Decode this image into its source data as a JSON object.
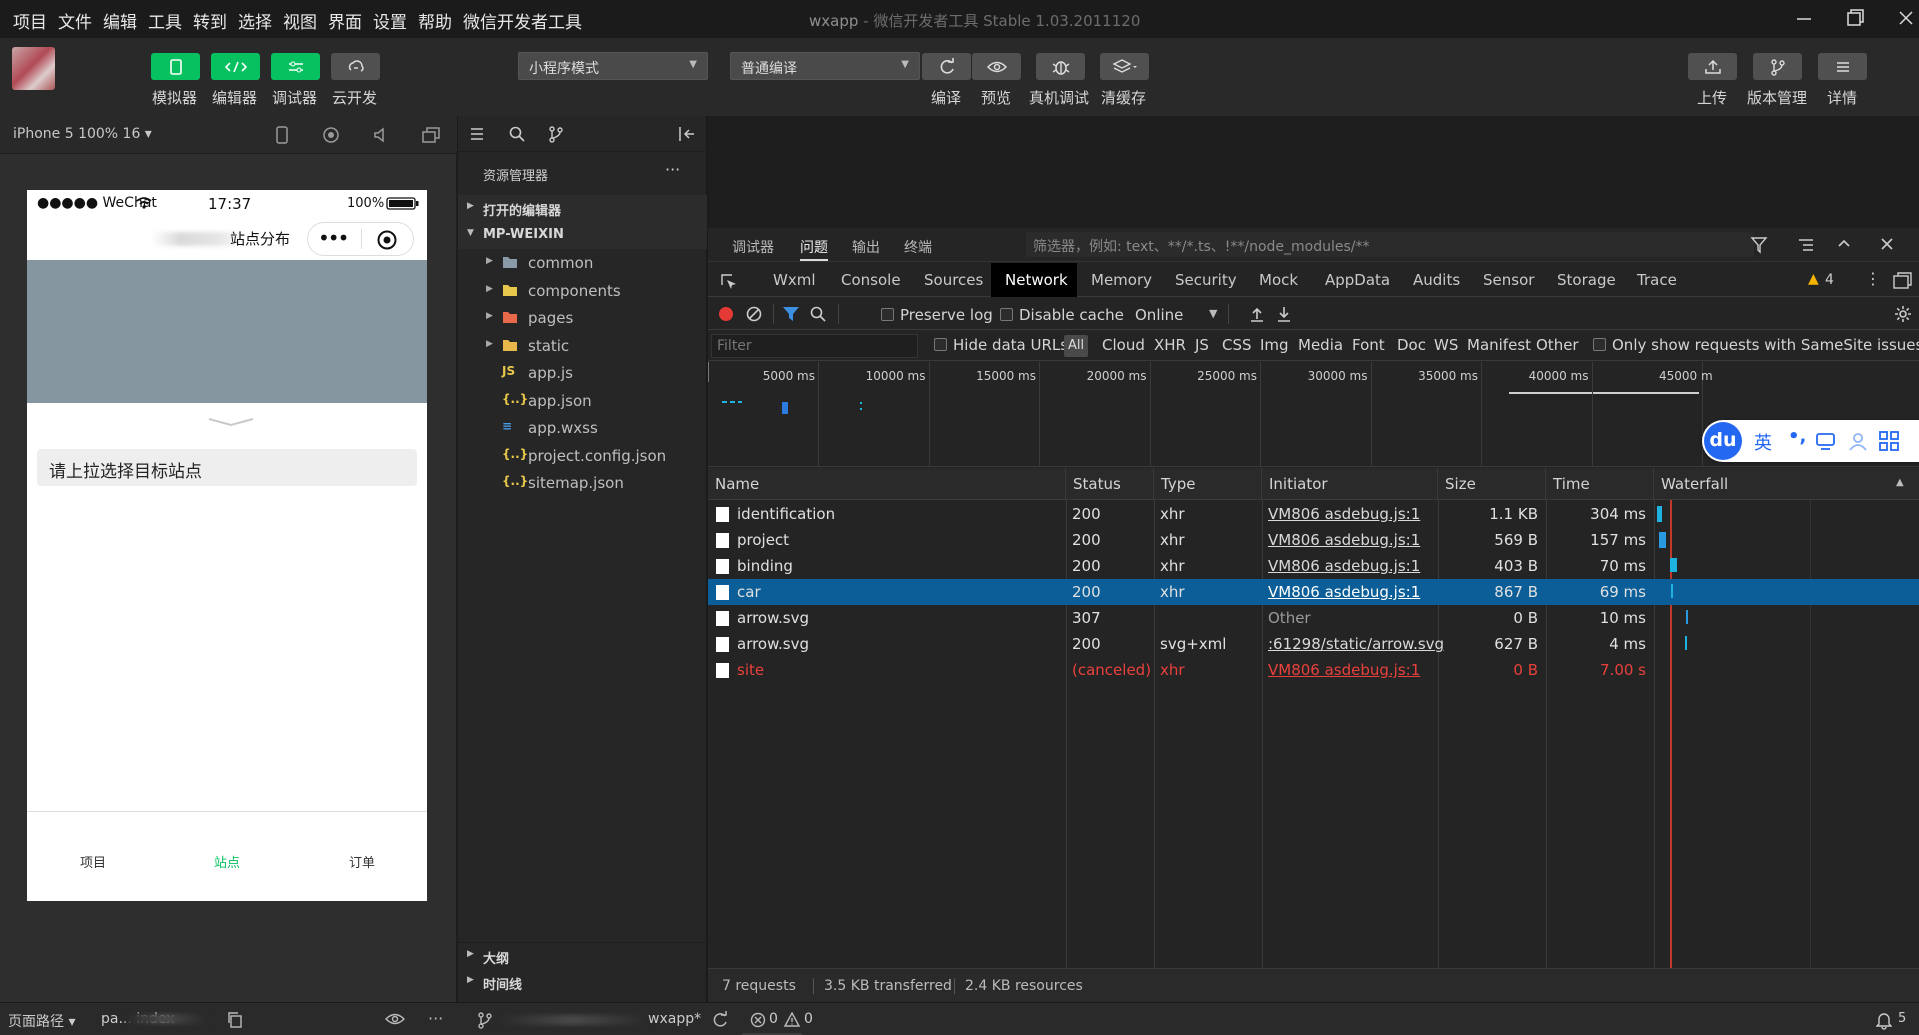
{
  "menubar": {
    "items": [
      "项目",
      "文件",
      "编辑",
      "工具",
      "转到",
      "选择",
      "视图",
      "界面",
      "设置",
      "帮助",
      "微信开发者工具"
    ],
    "title": "wxapp",
    "title_sub": " - 微信开发者工具 Stable 1.03.2011120"
  },
  "toolbar": {
    "simulator_label": "模拟器",
    "editor_label": "编辑器",
    "debugger_label": "调试器",
    "cloud_label": "云开发",
    "mode_select": "小程序模式",
    "compile_select": "普通编译",
    "compile_label": "编译",
    "preview_label": "预览",
    "remote_debug_label": "真机调试",
    "clear_cache_label": "清缓存",
    "upload_label": "上传",
    "version_label": "版本管理",
    "details_label": "详情",
    "accent": "#07c160"
  },
  "simulator": {
    "device": "iPhone 5 100% 16 ▾",
    "status_carrier": "●●●●● WeChat",
    "status_time": "17:37",
    "status_battery": "100%",
    "nav_title": "站点分布",
    "hint_text": "请上拉选择目标站点",
    "tabs": [
      "项目",
      "站点",
      "订单"
    ],
    "active_tab_color": "#07c160",
    "map_color": "#8596a1"
  },
  "explorer": {
    "title": "资源管理器",
    "more": "···",
    "open_editors": "打开的编辑器",
    "root": "MP-WEIXIN",
    "files": [
      {
        "name": "common",
        "icon": "folder-icon",
        "color": "#8a9aa8",
        "folder": true
      },
      {
        "name": "components",
        "icon": "folder-icon",
        "color": "#e8c84a",
        "folder": true
      },
      {
        "name": "pages",
        "icon": "folder-icon",
        "color": "#e86a4a",
        "folder": true
      },
      {
        "name": "static",
        "icon": "folder-icon",
        "color": "#e8b84a",
        "folder": true
      },
      {
        "name": "app.js",
        "icon": "js-file-icon",
        "color": "#e8c84a",
        "folder": false
      },
      {
        "name": "app.json",
        "icon": "json-file-icon",
        "color": "#e8c84a",
        "folder": false
      },
      {
        "name": "app.wxss",
        "icon": "wxss-file-icon",
        "color": "#4a9ae8",
        "folder": false
      },
      {
        "name": "project.config.json",
        "icon": "json-file-icon",
        "color": "#e8c84a",
        "folder": false
      },
      {
        "name": "sitemap.json",
        "icon": "json-file-icon",
        "color": "#e8c84a",
        "folder": false
      }
    ],
    "outline": "大纲",
    "timeline": "时间线"
  },
  "devtools": {
    "top_tabs": [
      "调试器",
      "问题",
      "输出",
      "终端"
    ],
    "filter_placeholder": "筛选器，例如: text、**/*.ts、!**/node_modules/**",
    "panel_tabs": [
      "Wxml",
      "Console",
      "Sources",
      "Network",
      "Memory",
      "Security",
      "Mock",
      "AppData",
      "Audits",
      "Sensor",
      "Storage",
      "Trace"
    ],
    "active_panel": "Network",
    "warning_count": "4",
    "preserve_log": "Preserve log",
    "disable_cache": "Disable cache",
    "throttle": "Online",
    "filter_input_placeholder": "Filter",
    "hide_data_urls": "Hide data URLs",
    "filter_types": [
      "All",
      "Cloud",
      "XHR",
      "JS",
      "CSS",
      "Img",
      "Media",
      "Font",
      "Doc",
      "WS",
      "Manifest",
      "Other"
    ],
    "samesite": "Only show requests with SameSite issues",
    "timeline_ticks": [
      "5000 ms",
      "10000 ms",
      "15000 ms",
      "20000 ms",
      "25000 ms",
      "30000 ms",
      "35000 ms",
      "40000 ms",
      "45000 m"
    ],
    "ime": {
      "logo": "du",
      "lang": "英",
      "punct": "•,"
    },
    "columns": [
      "Name",
      "Status",
      "Type",
      "Initiator",
      "Size",
      "Time",
      "Waterfall"
    ],
    "rows": [
      {
        "name": "identification",
        "status": "200",
        "type": "xhr",
        "initiator": "VM806 asdebug.js:1",
        "size": "1.1 KB",
        "time": "304 ms",
        "selected": false,
        "error": false,
        "link": true
      },
      {
        "name": "project",
        "status": "200",
        "type": "xhr",
        "initiator": "VM806 asdebug.js:1",
        "size": "569 B",
        "time": "157 ms",
        "selected": false,
        "error": false,
        "link": true
      },
      {
        "name": "binding",
        "status": "200",
        "type": "xhr",
        "initiator": "VM806 asdebug.js:1",
        "size": "403 B",
        "time": "70 ms",
        "selected": false,
        "error": false,
        "link": true
      },
      {
        "name": "car",
        "status": "200",
        "type": "xhr",
        "initiator": "VM806 asdebug.js:1",
        "size": "867 B",
        "time": "69 ms",
        "selected": true,
        "error": false,
        "link": true
      },
      {
        "name": "arrow.svg",
        "status": "307",
        "type": "",
        "initiator": "Other",
        "size": "0 B",
        "time": "10 ms",
        "selected": false,
        "error": false,
        "link": false
      },
      {
        "name": "arrow.svg",
        "status": "200",
        "type": "svg+xml",
        "initiator": ":61298/static/arrow.svg",
        "size": "627 B",
        "time": "4 ms",
        "selected": false,
        "error": false,
        "link": true
      },
      {
        "name": "site",
        "status": "(canceled)",
        "type": "xhr",
        "initiator": "VM806 asdebug.js:1",
        "size": "0 B",
        "time": "7.00 s",
        "selected": false,
        "error": true,
        "link": true
      }
    ],
    "summary": [
      "7 requests",
      "3.5 KB transferred",
      "2.4 KB resources"
    ]
  },
  "statusbar": {
    "path_label": "页面路径 ▾",
    "path_value": "pa... index",
    "branch": "wxapp*",
    "errors": "0",
    "warnings": "0",
    "notifications": "5"
  }
}
